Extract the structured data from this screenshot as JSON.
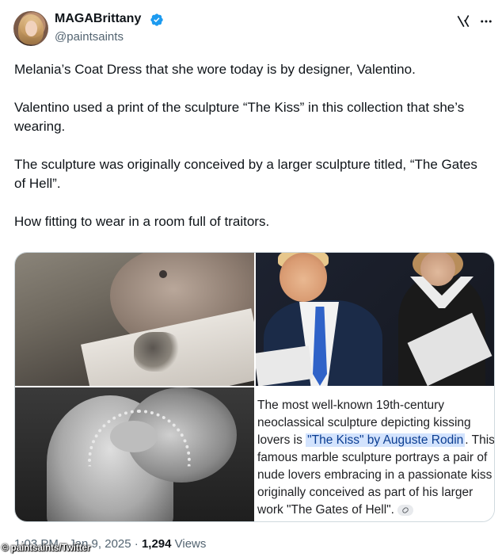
{
  "author": {
    "display_name": "MAGABrittany",
    "handle": "@paintsaints",
    "verified": true,
    "verified_color": "#1d9bf0"
  },
  "header_icons": [
    "grok-icon",
    "more-icon"
  ],
  "tweet": {
    "paragraphs": [
      "Melania’s Coat Dress that she wore today is by designer, Valentino.",
      "Valentino used a print of the sculpture “The Kiss” in this collection that she’s wearing.",
      "The sculpture was originally conceived by a larger sculpture titled, “The Gates of Hell”.",
      "How fitting to wear in a room full of traitors."
    ]
  },
  "media": {
    "search_snippet": {
      "before": "The most well-known 19th-century neoclassical sculpture depicting kissing lovers is ",
      "highlight": "\"The Kiss\" by Auguste Rodin",
      "after": ". This famous marble sculpture portrays a pair of nude lovers embracing in a passionate kiss originally conceived as part of his larger work \"The Gates of Hell\".",
      "lines": [
        "The most well-known 19th-century",
        "neoclassical sculpture depicting kissing",
        "lovers is ",
        ". This",
        "famous marble sculpture portrays a pair of",
        "nude lovers embracing in a passionate kiss",
        "originally conceived as part of his larger",
        "work \"The Gates of Hell\"."
      ]
    }
  },
  "meta": {
    "time": "1:03 PM · Jan 9, 2025",
    "separator": " · ",
    "views": "1,294",
    "views_label": " Views"
  },
  "watermark": "© paintsaints/Twitter"
}
